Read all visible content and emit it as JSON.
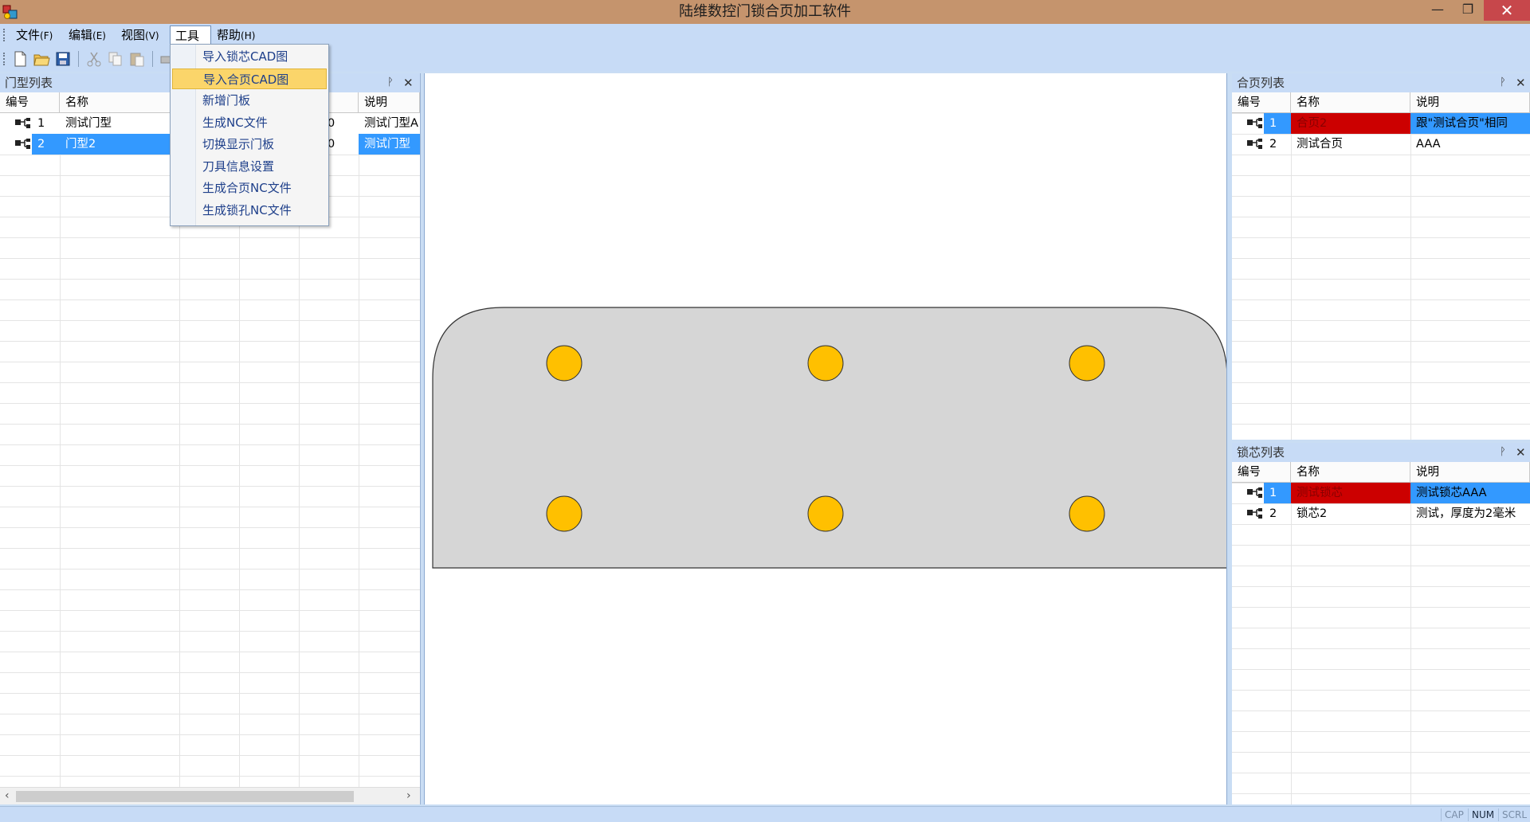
{
  "window": {
    "title": "陆维数控门锁合页加工软件",
    "minimize": "—",
    "restore": "❐",
    "close": "✕"
  },
  "menubar": {
    "items": [
      {
        "label": "文件",
        "acc": "(F)"
      },
      {
        "label": "编辑",
        "acc": "(E)"
      },
      {
        "label": "视图",
        "acc": "(V)"
      },
      {
        "label": "工具",
        "acc": ""
      },
      {
        "label": "帮助",
        "acc": "(H)"
      }
    ]
  },
  "toolbar": {
    "icons": [
      "new-file-icon",
      "open-folder-icon",
      "save-icon",
      "cut-icon",
      "copy-icon",
      "paste-icon",
      "print-icon"
    ]
  },
  "tools_menu": {
    "items": [
      "导入锁芯CAD图",
      "导入合页CAD图",
      "新增门板",
      "生成NC文件",
      "切换显示门板",
      "刀具信息设置",
      "生成合页NC文件",
      "生成锁孔NC文件"
    ],
    "highlighted_index": 1
  },
  "door_list": {
    "title": "门型列表",
    "pin": "ᚹ",
    "close": "✕",
    "columns": [
      "编号",
      "名称",
      "说明"
    ],
    "rows": [
      {
        "id": "1",
        "name": "测试门型",
        "hidden_frag": "0",
        "desc": "测试门型A"
      },
      {
        "id": "2",
        "name": "门型2",
        "hidden_frag": "0",
        "desc": "测试门型"
      }
    ],
    "selected_row": 1
  },
  "hinge_list": {
    "title": "合页列表",
    "pin": "ᚹ",
    "close": "✕",
    "columns": [
      "编号",
      "名称",
      "说明"
    ],
    "rows": [
      {
        "id": "1",
        "name": "合页2",
        "desc": "跟\"测试合页\"相同"
      },
      {
        "id": "2",
        "name": "测试合页",
        "desc": "AAA"
      }
    ],
    "selected_row": 0
  },
  "lock_list": {
    "title": "锁芯列表",
    "pin": "ᚹ",
    "close": "✕",
    "columns": [
      "编号",
      "名称",
      "说明"
    ],
    "rows": [
      {
        "id": "1",
        "name": "测试锁芯",
        "desc": "测试锁芯AAA"
      },
      {
        "id": "2",
        "name": "锁芯2",
        "desc": "测试，厚度为2毫米"
      }
    ],
    "selected_row": 0
  },
  "status": {
    "cap": "CAP",
    "num": "NUM",
    "scrl": "SCRL"
  },
  "colors": {
    "accent": "#3399ff",
    "hole": "#ffc000",
    "plate": "#d6d6d6",
    "selected_red": "#cc0000",
    "titlebar": "#c5946d"
  }
}
